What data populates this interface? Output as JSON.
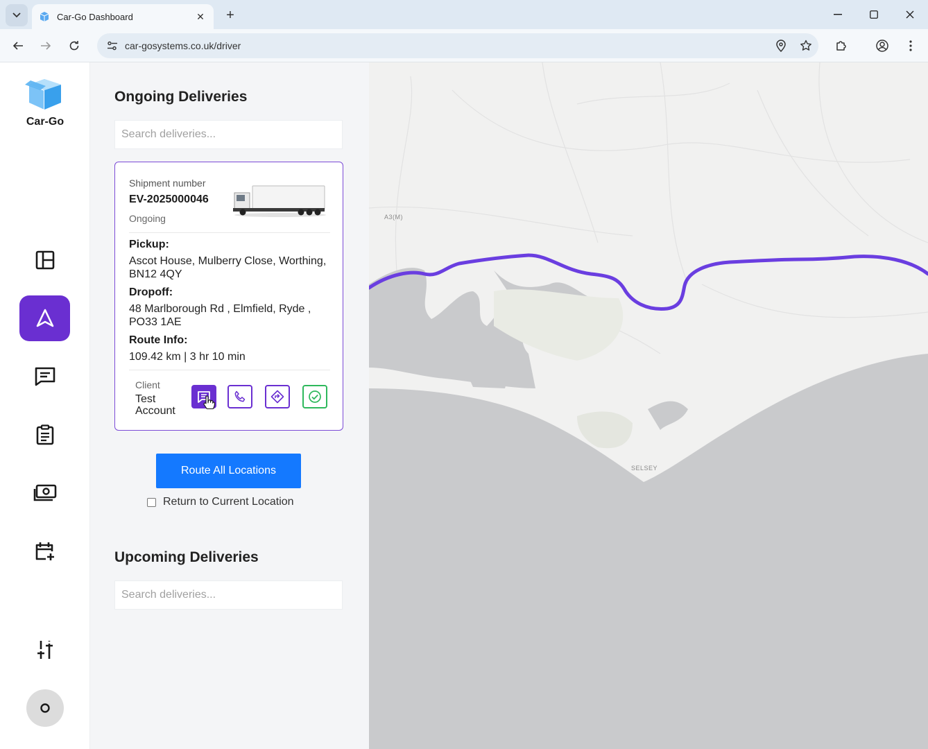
{
  "browser": {
    "tab_title": "Car-Go Dashboard",
    "url": "car-gosystems.co.uk/driver"
  },
  "app": {
    "logo_text": "Car-Go",
    "nav_icons": [
      "dashboard-icon",
      "navigation-icon",
      "messages-icon",
      "clipboard-icon",
      "payments-icon",
      "calendar-add-icon",
      "settings-sliders-icon"
    ],
    "active_nav": "navigation-icon",
    "accent_color": "#6a2fd1",
    "primary_button_color": "#1479ff"
  },
  "ongoing": {
    "title": "Ongoing Deliveries",
    "search_placeholder": "Search deliveries...",
    "card": {
      "shipment_label": "Shipment number",
      "shipment_number": "EV-2025000046",
      "status": "Ongoing",
      "pickup_label": "Pickup:",
      "pickup_address": "Ascot House, Mulberry Close, Worthing, BN12 4QY",
      "dropoff_label": "Dropoff:",
      "dropoff_address": "48 Marlborough Rd , Elmfield, Ryde , PO33 1AE",
      "route_label": "Route Info:",
      "route_info": "109.42 km | 3 hr 10 min",
      "client_label": "Client",
      "client_name": "Test Account",
      "actions": [
        "message-icon",
        "phone-icon",
        "directions-icon",
        "complete-check-icon"
      ]
    },
    "route_all_label": "Route All Locations",
    "return_label": "Return to Current Location",
    "return_checked": false
  },
  "upcoming": {
    "title": "Upcoming Deliveries",
    "search_placeholder": "Search deliveries..."
  },
  "map": {
    "labels": {
      "road": "A3(M)",
      "town": "SELSEY"
    },
    "route_color": "#6a3ee0"
  }
}
